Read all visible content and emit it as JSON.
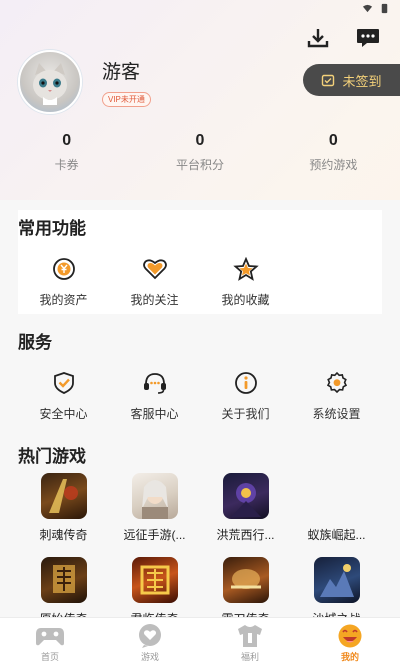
{
  "profile": {
    "username": "游客",
    "vip_badge": "VIP未开通",
    "signin_label": "未签到"
  },
  "stats": [
    {
      "value": "0",
      "label": "卡券"
    },
    {
      "value": "0",
      "label": "平台积分"
    },
    {
      "value": "0",
      "label": "预约游戏"
    }
  ],
  "common": {
    "title": "常用功能",
    "items": [
      {
        "label": "我的资产",
        "icon": "yen-coin-icon"
      },
      {
        "label": "我的关注",
        "icon": "heart-icon"
      },
      {
        "label": "我的收藏",
        "icon": "star-icon"
      }
    ]
  },
  "services": {
    "title": "服务",
    "items": [
      {
        "label": "安全中心",
        "icon": "shield-icon"
      },
      {
        "label": "客服中心",
        "icon": "headset-icon"
      },
      {
        "label": "关于我们",
        "icon": "info-icon"
      },
      {
        "label": "系统设置",
        "icon": "gear-icon"
      }
    ]
  },
  "hot_games": {
    "title": "热门游戏",
    "row1": [
      {
        "name": "刺魂传奇"
      },
      {
        "name": "远征手游(..."
      },
      {
        "name": "洪荒西行..."
      },
      {
        "name": "蚁族崛起..."
      }
    ],
    "row2": [
      {
        "name": "原始传奇"
      },
      {
        "name": "君临传奇"
      },
      {
        "name": "霸刀传奇"
      },
      {
        "name": "沙城之战"
      }
    ]
  },
  "tabbar": [
    {
      "label": "首页",
      "icon": "gamepad-icon",
      "active": false
    },
    {
      "label": "游戏",
      "icon": "game-bubble-icon",
      "active": false
    },
    {
      "label": "福利",
      "icon": "gift-shirt-icon",
      "active": false
    },
    {
      "label": "我的",
      "icon": "smiley-face-icon",
      "active": true
    }
  ],
  "colors": {
    "accent": "#f08a1e",
    "signin_bg": "#4a4a4a",
    "signin_text": "#f4d17a",
    "icon_orange": "#f39a2a"
  }
}
